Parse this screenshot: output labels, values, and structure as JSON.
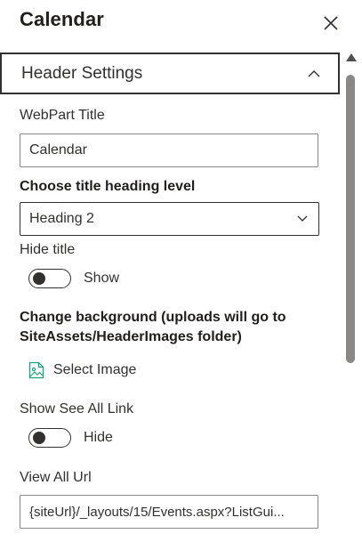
{
  "panel": {
    "title": "Calendar"
  },
  "accordion": {
    "header_label": "Header Settings"
  },
  "fields": {
    "webpart_title": {
      "label": "WebPart Title",
      "value": "Calendar"
    },
    "heading_level": {
      "label": "Choose title heading level",
      "selected": "Heading 2"
    },
    "hide_title": {
      "label": "Hide title",
      "toggle_state_label": "Show",
      "checked": false
    },
    "background": {
      "label": "Change background (uploads will go to SiteAssets/HeaderImages folder)",
      "select_image_label": "Select Image"
    },
    "see_all_link": {
      "label": "Show See All Link",
      "toggle_state_label": "Hide",
      "checked": false
    },
    "view_all_url": {
      "label": "View All Url",
      "value": "{siteUrl}/_layouts/15/Events.aspx?ListGui..."
    }
  },
  "colors": {
    "text": "#323130",
    "border": "#8a8886",
    "icon_accent": "#1ba37a"
  }
}
